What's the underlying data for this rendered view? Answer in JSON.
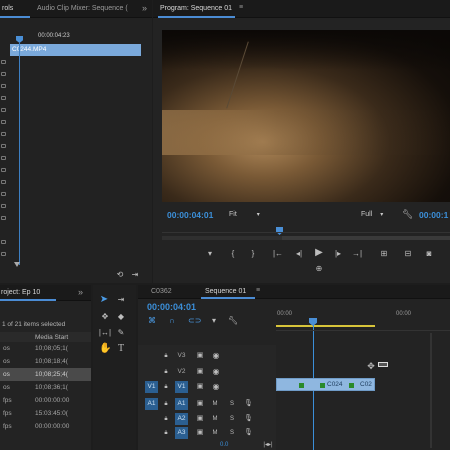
{
  "source_panel": {
    "tab_controls": "rols",
    "tab_mixer": "Audio Clip Mixer: Sequence (",
    "timecode": "00:00:04:23",
    "clip_name": "C0244.MP4",
    "expand": "»"
  },
  "program_monitor": {
    "title": "Program: Sequence 01",
    "menu": "≡",
    "timecode_current": "00:00:04:01",
    "zoom": "Fit",
    "resolution": "Full",
    "timecode_duration": "00:00:1"
  },
  "project": {
    "title": "roject: Ep 10",
    "expand": "»",
    "item_count": "1 of 21 items selected",
    "column_media_start": "Media Start",
    "rows": [
      {
        "name": "os",
        "start": "10;08;05;1("
      },
      {
        "name": "os",
        "start": "10;08;18;4("
      },
      {
        "name": "os",
        "start": "10;08;25;4("
      },
      {
        "name": "os",
        "start": "10;08;36;1("
      },
      {
        "name": "fps",
        "start": "00:00:00:00"
      },
      {
        "name": "fps",
        "start": "15:03:45:0("
      },
      {
        "name": "fps",
        "start": "00:00:00:00"
      }
    ]
  },
  "timeline": {
    "tab_inactive": "C0362",
    "tab_active": "Sequence 01",
    "menu": "≡",
    "timecode": "00:00:04:01",
    "ruler_labels": [
      "00:00",
      "00:00"
    ],
    "tracks": [
      {
        "id": "V3",
        "source": ""
      },
      {
        "id": "V2",
        "source": ""
      },
      {
        "id": "V1",
        "source": "V1"
      },
      {
        "id": "A1",
        "source": "A1"
      },
      {
        "id": "A2",
        "source": ""
      },
      {
        "id": "A3",
        "source": ""
      }
    ],
    "clip1": "C024",
    "clip2": "C02",
    "mute": "M",
    "solo": "S",
    "volume": "0.0"
  },
  "tools": {
    "type_tool": "T"
  }
}
